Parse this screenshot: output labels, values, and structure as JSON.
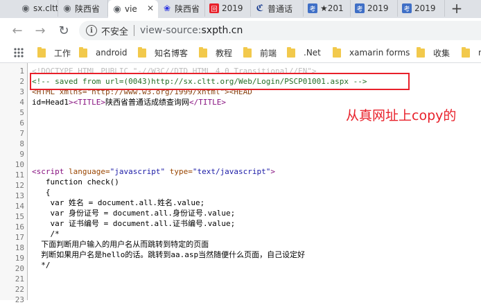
{
  "tabs": [
    {
      "label": "sx.cltt",
      "icon": "chrome-favicon",
      "color": "#5f6368",
      "glyph": "◉"
    },
    {
      "label": "陕西省",
      "icon": "chrome-favicon",
      "color": "#5f6368",
      "glyph": "◉"
    },
    {
      "label": "vie",
      "icon": "chrome-favicon",
      "color": "#5f6368",
      "glyph": "◉",
      "active": true
    },
    {
      "label": "陕西省",
      "icon": "baidu-paw-icon",
      "color": "#2932e1",
      "glyph": "🐾"
    },
    {
      "label": "2019",
      "icon": "red-square-icon",
      "color": "#e8202a",
      "glyph": "回"
    },
    {
      "label": "普通话",
      "icon": "cn-logo-icon",
      "color": "#1a3d8f",
      "glyph": "ℭ"
    },
    {
      "label": "★201",
      "icon": "kao-icon",
      "color": "#3f6fc6",
      "glyph": "考"
    },
    {
      "label": "2019",
      "icon": "kao-icon",
      "color": "#3f6fc6",
      "glyph": "考"
    },
    {
      "label": "2019",
      "icon": "kao-icon",
      "color": "#3f6fc6",
      "glyph": "考"
    }
  ],
  "address": {
    "security_label": "不安全",
    "scheme": "view-source:",
    "host": "sxpth.cn"
  },
  "bookmarks": [
    {
      "label": "工作"
    },
    {
      "label": "android"
    },
    {
      "label": "知名博客"
    },
    {
      "label": "教程"
    },
    {
      "label": "前端"
    },
    {
      "label": ".Net"
    },
    {
      "label": "xamarin forms"
    },
    {
      "label": "收集"
    },
    {
      "label": "n"
    }
  ],
  "source": {
    "line_numbers": [
      "1",
      "2",
      "3",
      "4",
      "5",
      "6",
      "7",
      "8",
      "9",
      "10",
      "11",
      "12",
      "13",
      "14",
      "15",
      "16",
      "17",
      "18",
      "19",
      "20",
      "21",
      "22",
      "23"
    ],
    "line1": "<!DOCTYPE HTML PUBLIC \"-//W3C//DTD HTML 4.0 Transitional//EN\">",
    "line2": "<!-- saved from url=(0043)http://sx.cltt.org/Web/Login/PSCP01001.aspx -->",
    "line3a": "<HTML xmlns=\"http://www.w3.org/1999/xhtml\">",
    "line3b": "<HEAD",
    "line4_attr": "id=",
    "line4_val": "Head1",
    "line4_open": "><TITLE>",
    "line4_text": "陕西省普通话成绩查询网",
    "line4_close": "</TITLE>",
    "line11_open": "<script ",
    "line11_a1": "language=",
    "line11_v1": "\"javascript\"",
    "line11_a2": " type=",
    "line11_v2": "\"text/javascript\"",
    "line11_end": ">",
    "line12": "   function check()",
    "line13": "   {",
    "line14": "    var 姓名 = document.all.姓名.value;",
    "line15": "    var 身份证号 = document.all.身份证号.value;",
    "line16": "    var 证书编号 = document.all.证书编号.value;",
    "line17": "    /*",
    "line18": "  下面判断用户输入的用户名从而跳转到特定的页面",
    "line19": "  判断如果用户名是hello的话。跳转到aa.asp当然随便什么页面，自己设定好",
    "line20": "  */"
  },
  "annotation": "从真网址上copy的"
}
